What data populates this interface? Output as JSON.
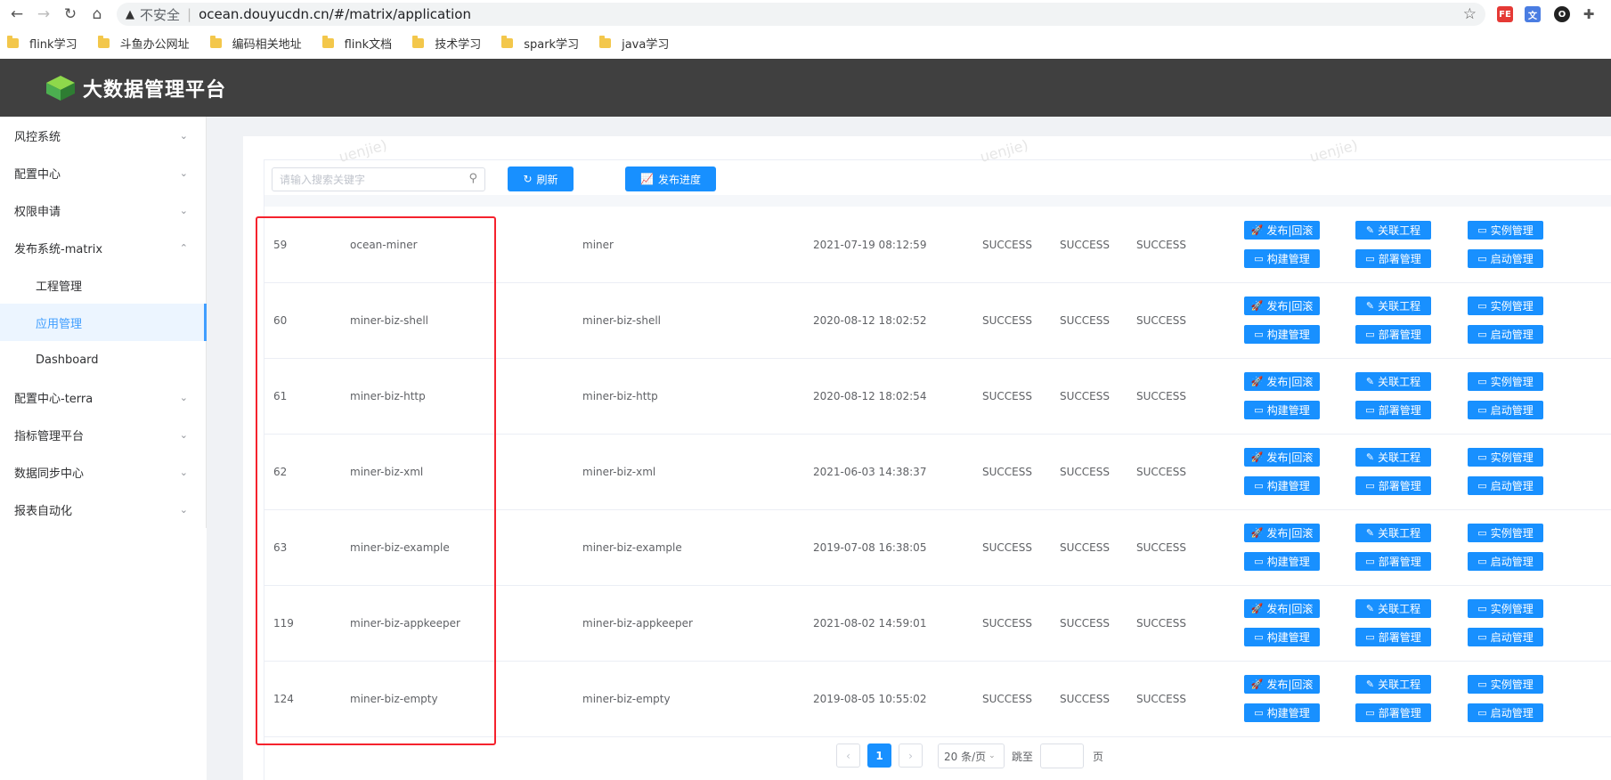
{
  "browser": {
    "security_label": "不安全",
    "url": "ocean.douyucdn.cn/#/matrix/application",
    "bookmarks": [
      "flink学习",
      "斗鱼办公网址",
      "编码相关地址",
      "flink文档",
      "技术学习",
      "spark学习",
      "java学习"
    ]
  },
  "header": {
    "title": "大数据管理平台"
  },
  "sidebar": {
    "items": [
      {
        "label": "风控系统",
        "expanded": false
      },
      {
        "label": "配置中心",
        "expanded": false
      },
      {
        "label": "权限申请",
        "expanded": false
      },
      {
        "label": "发布系统-matrix",
        "expanded": true
      },
      {
        "label": "工程管理",
        "sub": true
      },
      {
        "label": "应用管理",
        "sub": true,
        "active": true
      },
      {
        "label": "Dashboard",
        "sub": true
      },
      {
        "label": "配置中心-terra",
        "expanded": false
      },
      {
        "label": "指标管理平台",
        "expanded": false
      },
      {
        "label": "数据同步中心",
        "expanded": false
      },
      {
        "label": "报表自动化",
        "expanded": false
      }
    ]
  },
  "toolbar": {
    "search_placeholder": "请输入搜索关键字",
    "refresh_label": "刷新",
    "progress_label": "发布进度"
  },
  "watermark": "uenjie)",
  "actions": {
    "publish": "发布|回滚",
    "link_project": "关联工程",
    "instance": "实例管理",
    "build": "构建管理",
    "deploy": "部署管理",
    "start": "启动管理"
  },
  "rows": [
    {
      "id": "59",
      "name": "ocean-miner",
      "project": "miner",
      "time": "2021-07-19 08:12:59",
      "s1": "SUCCESS",
      "s2": "SUCCESS",
      "s3": "SUCCESS"
    },
    {
      "id": "60",
      "name": "miner-biz-shell",
      "project": "miner-biz-shell",
      "time": "2020-08-12 18:02:52",
      "s1": "SUCCESS",
      "s2": "SUCCESS",
      "s3": "SUCCESS"
    },
    {
      "id": "61",
      "name": "miner-biz-http",
      "project": "miner-biz-http",
      "time": "2020-08-12 18:02:54",
      "s1": "SUCCESS",
      "s2": "SUCCESS",
      "s3": "SUCCESS"
    },
    {
      "id": "62",
      "name": "miner-biz-xml",
      "project": "miner-biz-xml",
      "time": "2021-06-03 14:38:37",
      "s1": "SUCCESS",
      "s2": "SUCCESS",
      "s3": "SUCCESS"
    },
    {
      "id": "63",
      "name": "miner-biz-example",
      "project": "miner-biz-example",
      "time": "2019-07-08 16:38:05",
      "s1": "SUCCESS",
      "s2": "SUCCESS",
      "s3": "SUCCESS"
    },
    {
      "id": "119",
      "name": "miner-biz-appkeeper",
      "project": "miner-biz-appkeeper",
      "time": "2021-08-02 14:59:01",
      "s1": "SUCCESS",
      "s2": "SUCCESS",
      "s3": "SUCCESS"
    },
    {
      "id": "124",
      "name": "miner-biz-empty",
      "project": "miner-biz-empty",
      "time": "2019-08-05 10:55:02",
      "s1": "SUCCESS",
      "s2": "SUCCESS",
      "s3": "SUCCESS"
    }
  ],
  "pagination": {
    "current_page": "1",
    "page_size": "20 条/页",
    "jump_label": "跳至",
    "page_unit": "页"
  },
  "colors": {
    "accent": "#1890ff",
    "header_bg": "#404040",
    "highlight_box": "#f5222d"
  }
}
